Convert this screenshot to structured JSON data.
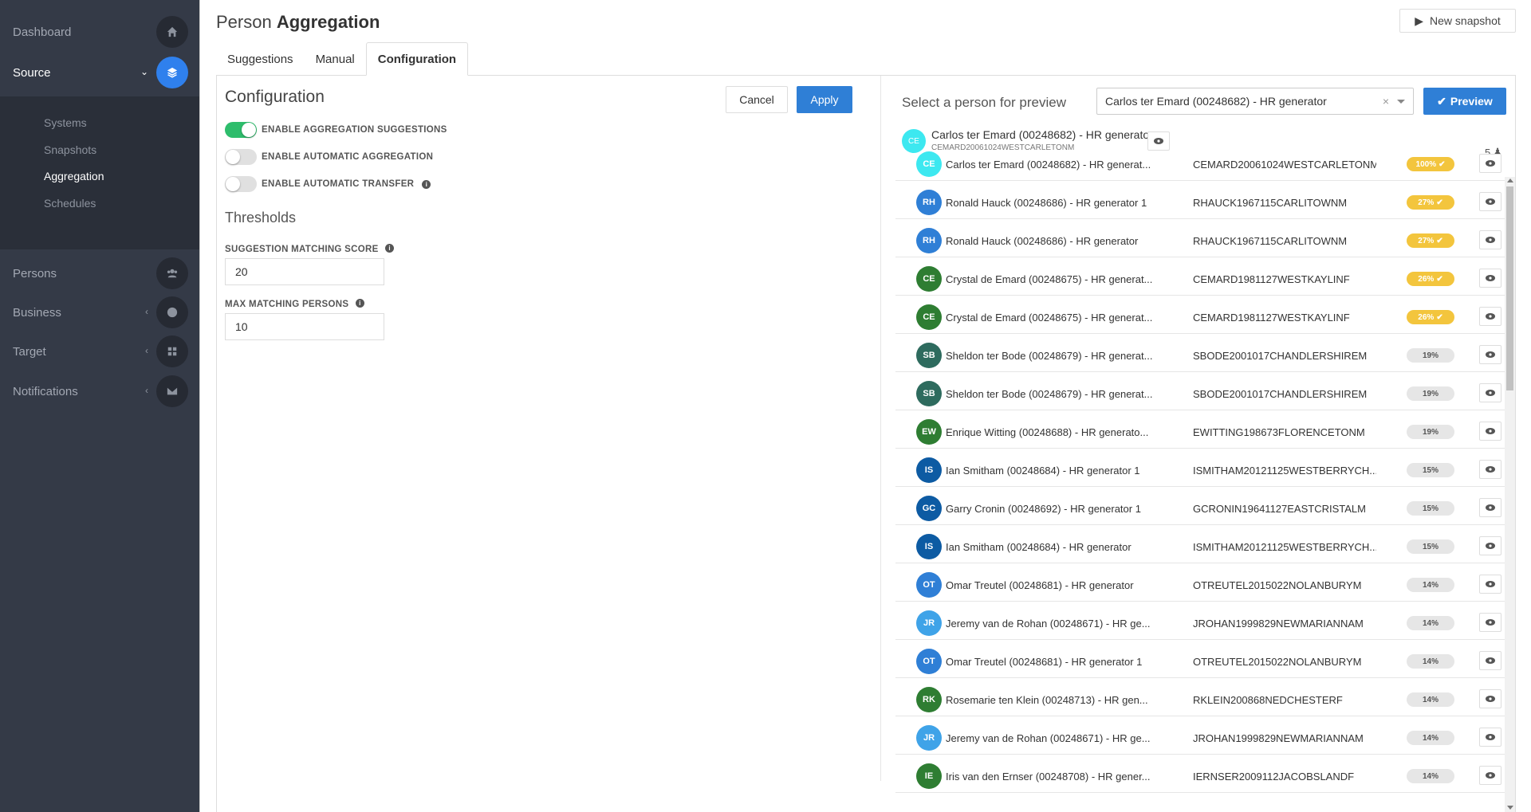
{
  "sidebar": {
    "items": [
      {
        "label": "Dashboard",
        "icon": "home-icon"
      },
      {
        "label": "Source",
        "icon": "layers-icon"
      },
      {
        "label": "Persons",
        "icon": "users-icon"
      },
      {
        "label": "Business",
        "icon": "globe-icon"
      },
      {
        "label": "Target",
        "icon": "grid-icon"
      },
      {
        "label": "Notifications",
        "icon": "envelope-icon"
      }
    ],
    "submenu": [
      "Systems",
      "Snapshots",
      "Aggregation",
      "Schedules"
    ],
    "active_submenu": "Aggregation"
  },
  "header": {
    "title_prefix": "Person",
    "title_main": "Aggregation",
    "new_snapshot_label": "New snapshot"
  },
  "tabs": [
    "Suggestions",
    "Manual",
    "Configuration"
  ],
  "active_tab": "Configuration",
  "config": {
    "title": "Configuration",
    "cancel_label": "Cancel",
    "apply_label": "Apply",
    "toggles": [
      {
        "label": "ENABLE AGGREGATION SUGGESTIONS",
        "on": true
      },
      {
        "label": "ENABLE AUTOMATIC AGGREGATION",
        "on": false
      },
      {
        "label": "ENABLE AUTOMATIC TRANSFER",
        "on": false
      }
    ],
    "thresholds_title": "Thresholds",
    "suggestion_score_label": "SUGGESTION MATCHING SCORE",
    "suggestion_score_value": "20",
    "max_persons_label": "MAX MATCHING PERSONS",
    "max_persons_value": "10"
  },
  "preview": {
    "select_label": "Select a person for preview",
    "selected_value": "Carlos ter Emard (00248682) - HR generator",
    "clear_symbol": "×",
    "preview_button": "Preview",
    "selected": {
      "initials": "CE",
      "name": "Carlos ter Emard (00248682) - HR generator",
      "id": "CEMARD20061024WESTCARLETONM"
    },
    "count": "5",
    "rows": [
      {
        "initials": "CE",
        "color": "#3de8f0",
        "name": "Carlos ter Emard (00248682) - HR generat...",
        "id": "CEMARD20061024WESTCARLETONM",
        "score": "100%",
        "high": true
      },
      {
        "initials": "RH",
        "color": "#2f7fd6",
        "name": "Ronald Hauck (00248686) - HR generator 1",
        "id": "RHAUCK1967115CARLITOWNM",
        "score": "27%",
        "high": true
      },
      {
        "initials": "RH",
        "color": "#2f7fd6",
        "name": "Ronald Hauck (00248686) - HR generator",
        "id": "RHAUCK1967115CARLITOWNM",
        "score": "27%",
        "high": true
      },
      {
        "initials": "CE",
        "color": "#2e7d32",
        "name": "Crystal de Emard (00248675) - HR generat...",
        "id": "CEMARD1981127WESTKAYLINF",
        "score": "26%",
        "high": true
      },
      {
        "initials": "CE",
        "color": "#2e7d32",
        "name": "Crystal de Emard (00248675) - HR generat...",
        "id": "CEMARD1981127WESTKAYLINF",
        "score": "26%",
        "high": true
      },
      {
        "initials": "SB",
        "color": "#2e6b5e",
        "name": "Sheldon ter Bode (00248679) - HR generat...",
        "id": "SBODE2001017CHANDLERSHIREM",
        "score": "19%",
        "high": false
      },
      {
        "initials": "SB",
        "color": "#2e6b5e",
        "name": "Sheldon ter Bode (00248679) - HR generat...",
        "id": "SBODE2001017CHANDLERSHIREM",
        "score": "19%",
        "high": false
      },
      {
        "initials": "EW",
        "color": "#2e7d32",
        "name": "Enrique Witting (00248688) - HR generato...",
        "id": "EWITTING198673FLORENCETONM",
        "score": "19%",
        "high": false
      },
      {
        "initials": "IS",
        "color": "#0d5ba3",
        "name": "Ian Smitham (00248684) - HR generator 1",
        "id": "ISMITHAM20121125WESTBERRYCH...",
        "score": "15%",
        "high": false
      },
      {
        "initials": "GC",
        "color": "#0d5ba3",
        "name": "Garry Cronin (00248692) - HR generator 1",
        "id": "GCRONIN19641127EASTCRISTALM",
        "score": "15%",
        "high": false
      },
      {
        "initials": "IS",
        "color": "#0d5ba3",
        "name": "Ian Smitham (00248684) - HR generator",
        "id": "ISMITHAM20121125WESTBERRYCH...",
        "score": "15%",
        "high": false
      },
      {
        "initials": "OT",
        "color": "#2f7fd6",
        "name": "Omar Treutel (00248681) - HR generator",
        "id": "OTREUTEL2015022NOLANBURYM",
        "score": "14%",
        "high": false
      },
      {
        "initials": "JR",
        "color": "#3fa3e8",
        "name": "Jeremy van de Rohan (00248671) - HR ge...",
        "id": "JROHAN1999829NEWMARIANNAM",
        "score": "14%",
        "high": false
      },
      {
        "initials": "OT",
        "color": "#2f7fd6",
        "name": "Omar Treutel (00248681) - HR generator 1",
        "id": "OTREUTEL2015022NOLANBURYM",
        "score": "14%",
        "high": false
      },
      {
        "initials": "RK",
        "color": "#2e7d32",
        "name": "Rosemarie ten Klein (00248713) - HR gen...",
        "id": "RKLEIN200868NEDCHESTERF",
        "score": "14%",
        "high": false
      },
      {
        "initials": "JR",
        "color": "#3fa3e8",
        "name": "Jeremy van de Rohan (00248671) - HR ge...",
        "id": "JROHAN1999829NEWMARIANNAM",
        "score": "14%",
        "high": false
      },
      {
        "initials": "IE",
        "color": "#2e7d32",
        "name": "Iris van den Ernser (00248708) - HR gener...",
        "id": "IERNSER2009112JACOBSLANDF",
        "score": "14%",
        "high": false
      }
    ]
  },
  "colors": {
    "sidebar_bg": "#343a47",
    "accent_blue": "#2f7fd6",
    "toggle_on": "#2ebd6c",
    "score_high": "#f3c53d"
  }
}
